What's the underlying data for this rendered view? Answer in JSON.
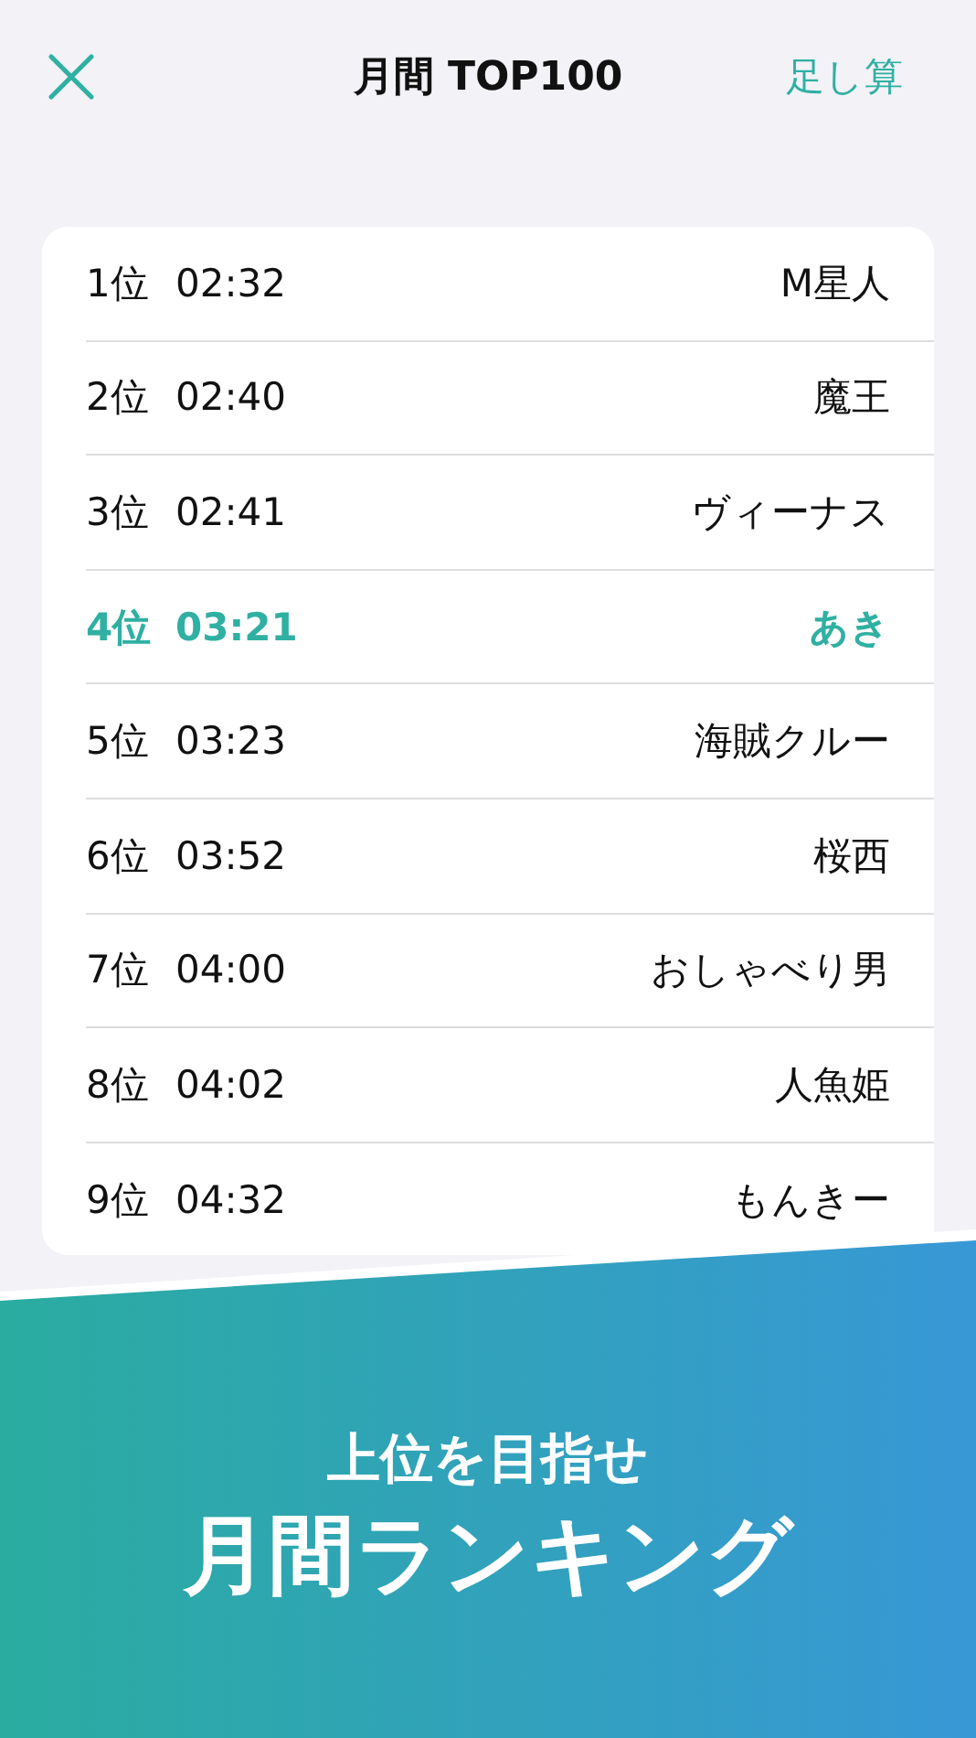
{
  "header": {
    "title": "月間 TOP100",
    "action": "足し算"
  },
  "ranking": [
    {
      "rank": "1位",
      "time": "02:32",
      "name": "M星人",
      "highlighted": false
    },
    {
      "rank": "2位",
      "time": "02:40",
      "name": "魔王",
      "highlighted": false
    },
    {
      "rank": "3位",
      "time": "02:41",
      "name": "ヴィーナス",
      "highlighted": false
    },
    {
      "rank": "4位",
      "time": "03:21",
      "name": "あき",
      "highlighted": true
    },
    {
      "rank": "5位",
      "time": "03:23",
      "name": "海賊クルー",
      "highlighted": false
    },
    {
      "rank": "6位",
      "time": "03:52",
      "name": "桜西",
      "highlighted": false
    },
    {
      "rank": "7位",
      "time": "04:00",
      "name": "おしゃべり男",
      "highlighted": false
    },
    {
      "rank": "8位",
      "time": "04:02",
      "name": "人魚姫",
      "highlighted": false
    },
    {
      "rank": "9位",
      "time": "04:32",
      "name": "もんきー",
      "highlighted": false
    }
  ],
  "banner": {
    "subtitle": "上位を目指せ",
    "title": "月間ランキング"
  }
}
